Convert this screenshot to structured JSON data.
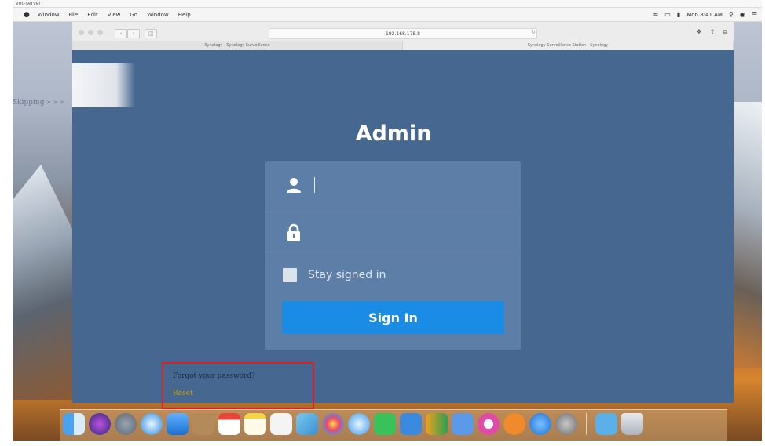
{
  "window": {
    "title": "vnc-server"
  },
  "menubar": {
    "items": [
      "Window",
      "File",
      "Edit",
      "View",
      "Go",
      "Window",
      "Help"
    ],
    "clock": "Mon 8:41 AM"
  },
  "browser": {
    "address": "192.168.178.8",
    "tabs": [
      "Synology - Synology Surveillance",
      "Synology Surveillance Station - Synology"
    ]
  },
  "sidebar": {
    "text": "Skipping » » »"
  },
  "login": {
    "title": "Admin",
    "username_value": "",
    "password_value": "",
    "stay_signed_in_label": "Stay signed in",
    "stay_signed_in_checked": false,
    "sign_in_label": "Sign In",
    "forgot_question": "Forgot your password?",
    "forgot_link": "Reset"
  },
  "colors": {
    "page_bg": "#46678f",
    "card_bg": "#5d7ea6",
    "button_bg": "#1a8ce6",
    "highlight": "#e01f1f"
  },
  "dock": {
    "icons": [
      "finder-icon",
      "siri-icon",
      "launchpad-icon",
      "safari-icon",
      "mail-icon",
      "contacts-icon",
      "calendar-icon",
      "notes-icon",
      "reminders-icon",
      "photos-icon",
      "photo-booth-icon",
      "messages-icon",
      "facetime-icon",
      "pages-icon",
      "numbers-icon",
      "keynote-icon",
      "itunes-icon",
      "ibooks-icon",
      "app-store-icon",
      "system-preferences-icon",
      "downloads-icon",
      "trash-icon"
    ]
  }
}
